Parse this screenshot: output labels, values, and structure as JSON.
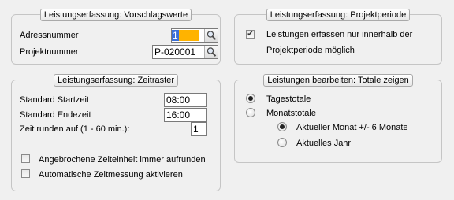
{
  "vorschlag": {
    "title": "Leistungserfassung: Vorschlagswerte",
    "adressnummer_label": "Adressnummer",
    "adressnummer_value": "1",
    "projektnummer_label": "Projektnummer",
    "projektnummer_value": "P-020001",
    "search_icon": "magnifier-icon",
    "highlight_color": "#ffb300"
  },
  "projektperiode": {
    "title": "Leistungserfassung: Projektperiode",
    "checkbox_label_line1": "Leistungen erfassen nur innerhalb der",
    "checkbox_label_line2": "Projektperiode möglich",
    "checked": true
  },
  "zeitraster": {
    "title": "Leistungserfassung: Zeitraster",
    "startzeit_label": "Standard Startzeit",
    "startzeit_value": "08:00",
    "endezeit_label": "Standard Endezeit",
    "endezeit_value": "16:00",
    "runden_label": "Zeit runden auf (1 - 60 min.):",
    "runden_value": "1",
    "aufrunden_label": "Angebrochene Zeiteinheit immer aufrunden",
    "aufrunden_checked": false,
    "automatik_label": "Automatische Zeitmessung aktivieren",
    "automatik_checked": false
  },
  "totale": {
    "title": "Leistungen bearbeiten: Totale zeigen",
    "tagestotale_label": "Tagestotale",
    "tagestotale_selected": true,
    "monatstotale_label": "Monatstotale",
    "monatstotale_selected": false,
    "aktueller_monat_label": "Aktueller Monat +/- 6 Monate",
    "aktueller_monat_selected": true,
    "aktuelles_jahr_label": "Aktuelles Jahr",
    "aktuelles_jahr_selected": false
  }
}
